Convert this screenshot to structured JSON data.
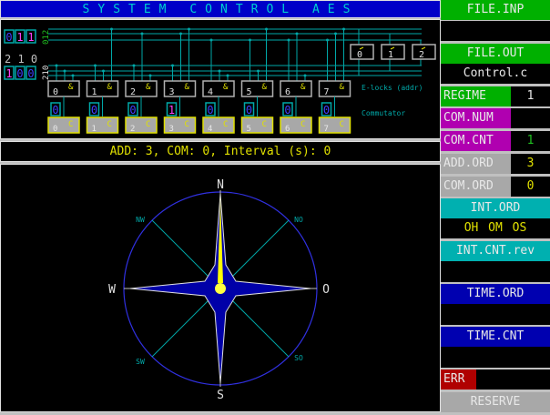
{
  "title": "SYSTEM CONTROL AES",
  "circuit": {
    "top_bits": [
      "0",
      "1",
      "1"
    ],
    "top_bus_label": "012",
    "bit_positions": "2 1 0",
    "bottom_bits": [
      "1",
      "0",
      "0"
    ],
    "bottom_bus_label": "210",
    "gates": [
      "0",
      "1",
      "2",
      "3",
      "4",
      "5",
      "6",
      "7"
    ],
    "gate_symbol": "&",
    "commutator_values": [
      "0",
      "0",
      "0",
      "1",
      "0",
      "0",
      "0",
      "0"
    ],
    "commutator_symbol": "C",
    "outputs": [
      "0",
      "1",
      "2"
    ],
    "elocks_label": "E-locks (addr)",
    "commutator_label": "Commutator"
  },
  "status": "ADD: 3, COM: 0, Interval (s): 0",
  "compass": {
    "N": "N",
    "S": "S",
    "W": "W",
    "O": "O",
    "NW": "NW",
    "NO": "NO",
    "SW": "SW",
    "SO": "SO"
  },
  "panel": {
    "file_inp": {
      "label": "FILE.INP",
      "value": ""
    },
    "file_out": {
      "label": "FILE.OUT",
      "value": "Control.c"
    },
    "regime": {
      "label": "REGIME",
      "value": "1"
    },
    "com_num": {
      "label": "COM.NUM",
      "value": ""
    },
    "com_cnt": {
      "label": "COM.CNT",
      "value": "1"
    },
    "add_ord": {
      "label": "ADD.ORD",
      "value": "3"
    },
    "com_ord": {
      "label": "COM.ORD",
      "value": "0"
    },
    "int_ord": {
      "label": "INT.ORD",
      "value": "OH OM OS"
    },
    "int_cnt": {
      "label": "INT.CNT.rev",
      "value": ""
    },
    "time_ord": {
      "label": "TIME.ORD",
      "value": ""
    },
    "time_cnt": {
      "label": "TIME.CNT",
      "value": ""
    },
    "err": {
      "label": "ERR",
      "value": ""
    },
    "reserve": {
      "label": "RESERVE"
    }
  },
  "colors": {
    "green": "#00b000",
    "magenta": "#b000b0",
    "gray": "#a8a8a8",
    "cyan": "#00b0b0",
    "navy": "#0000b0",
    "red": "#b00000",
    "wire": "#00a8a8",
    "yellow": "#e0e000"
  }
}
